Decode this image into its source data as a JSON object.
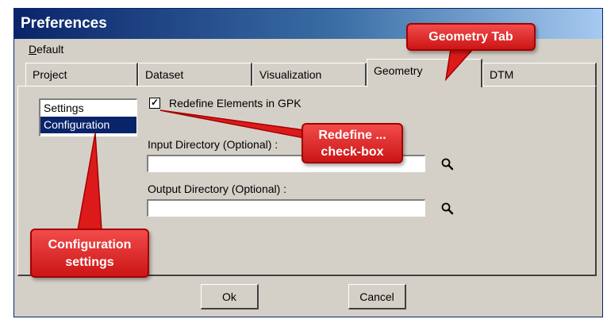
{
  "window": {
    "title": "Preferences"
  },
  "menu": {
    "items": [
      "Default"
    ]
  },
  "tabs": [
    {
      "label": "Project",
      "active": false
    },
    {
      "label": "Dataset",
      "active": false
    },
    {
      "label": "Visualization",
      "active": false
    },
    {
      "label": "Geometry",
      "active": true
    },
    {
      "label": "DTM",
      "active": false
    }
  ],
  "list": {
    "items": [
      "Settings",
      "Configuration"
    ],
    "selected": "Configuration"
  },
  "checkbox": {
    "label": "Redefine Elements in GPK",
    "checked": true
  },
  "fields": {
    "input_dir": {
      "label": "Input Directory (Optional) :",
      "value": ""
    },
    "output_dir": {
      "label": "Output Directory (Optional) :",
      "value": ""
    }
  },
  "buttons": {
    "ok": "Ok",
    "cancel": "Cancel"
  },
  "callouts": {
    "geometry_tab": "Geometry Tab",
    "redefine_line1": "Redefine ...",
    "redefine_line2": "check-box",
    "config_line1": "Configuration",
    "config_line2": "settings"
  },
  "colors": {
    "callout": "#e02020",
    "title_bar": "#0a246a",
    "selection": "#0a246a",
    "dialog": "#d4d0c8"
  },
  "icons": {
    "browse": "magnifier-icon"
  }
}
